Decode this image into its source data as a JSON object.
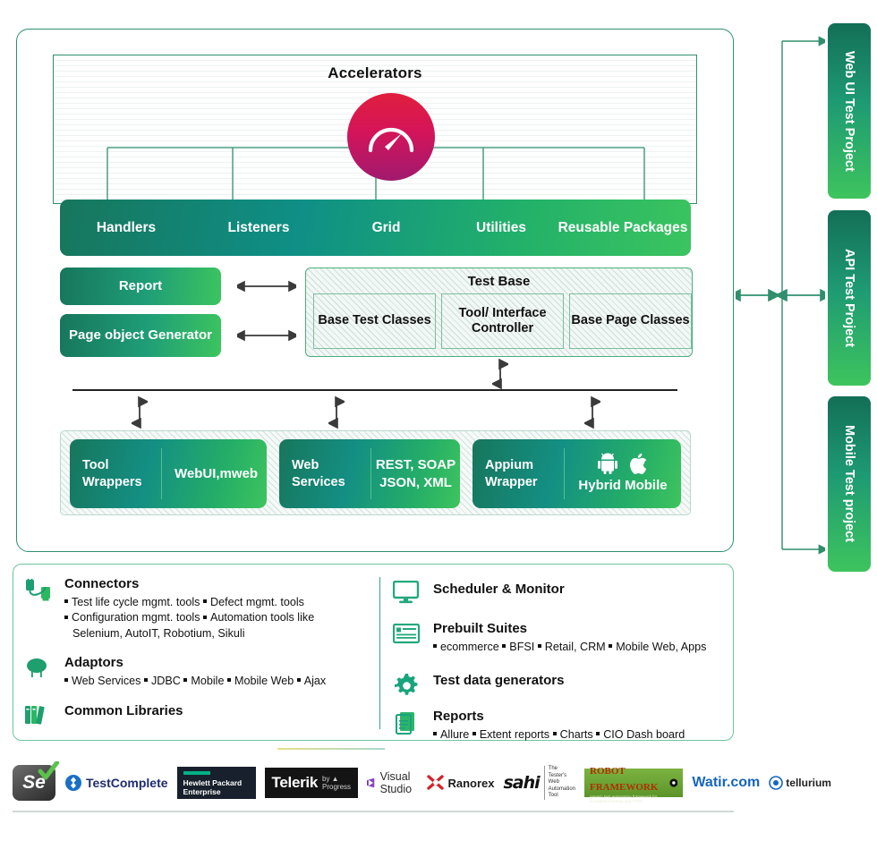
{
  "accelerators": {
    "title": "Accelerators",
    "icon": "speedometer-icon",
    "items": [
      "Handlers",
      "Listeners",
      "Grid",
      "Utilities",
      "Reusable Packages"
    ]
  },
  "left_column": {
    "report": "Report",
    "page_object_generator": "Page object Generator"
  },
  "test_base": {
    "title": "Test Base",
    "cells": [
      "Base Test Classes",
      "Tool/ Interface Controller",
      "Base Page Classes"
    ]
  },
  "wrappers": [
    {
      "left": "Tool Wrappers",
      "right": "WebUI,mweb",
      "icons": []
    },
    {
      "left": "Web Services",
      "right": "REST, SOAP JSON, XML",
      "icons": []
    },
    {
      "left": "Appium Wrapper",
      "right": "Hybrid Mobile",
      "icons": [
        "android-icon",
        "apple-icon"
      ]
    }
  ],
  "test_projects": [
    "Web UI Test Project",
    "API Test Project",
    "Mobile Test project"
  ],
  "services_left": [
    {
      "icon": "connector-plug-icon",
      "title": "Connectors",
      "lines": [
        [
          "Test life cycle mgmt. tools",
          "Defect mgmt. tools"
        ],
        [
          "Configuration mgmt. tools",
          "Automation tools like"
        ]
      ],
      "continuation": "Selenium, AutoIT, Robotium, Sikuli"
    },
    {
      "icon": "capacitor-icon",
      "title": "Adaptors",
      "lines": [
        [
          "Web Services",
          "JDBC",
          "Mobile",
          "Mobile Web",
          "Ajax"
        ]
      ],
      "continuation": ""
    },
    {
      "icon": "books-icon",
      "title": "Common Libraries",
      "lines": [],
      "continuation": ""
    }
  ],
  "services_right": [
    {
      "icon": "monitor-icon",
      "title": "Scheduler & Monitor",
      "lines": []
    },
    {
      "icon": "card-document-icon",
      "title": "Prebuilt Suites",
      "lines": [
        [
          "ecommerce",
          "BFSI",
          "Retail, CRM",
          "Mobile Web, Apps"
        ]
      ]
    },
    {
      "icon": "gear-icon",
      "title": "Test data generators",
      "lines": []
    },
    {
      "icon": "documents-icon",
      "title": "Reports",
      "lines": [
        [
          "Allure",
          "Extent reports",
          "Charts",
          "CIO Dash board"
        ]
      ]
    }
  ],
  "logos": [
    {
      "name": "selenium-logo",
      "text": "Se"
    },
    {
      "name": "testcomplete-logo",
      "text": "TestComplete"
    },
    {
      "name": "hpe-logo",
      "line1": "Hewlett Packard",
      "line2": "Enterprise"
    },
    {
      "name": "telerik-logo",
      "text": "Telerik",
      "sub": "by ▲ Progress"
    },
    {
      "name": "visual-studio-logo",
      "text": "Visual Studio"
    },
    {
      "name": "ranorex-logo",
      "text": "Ranorex"
    },
    {
      "name": "sahi-logo",
      "text": "sahi",
      "sub": "The Tester's Web Automation Tool"
    },
    {
      "name": "robot-framework-logo",
      "text": "ROBOT FRAMEWORK",
      "sub": "generic test automation framework for acceptance testing and ATDD"
    },
    {
      "name": "watir-logo",
      "text": "Watir.com"
    },
    {
      "name": "tellurium-logo",
      "text": "tellurium"
    }
  ],
  "colors": {
    "green_dark": "#17765c",
    "green_light": "#3ec45e",
    "teal": "#0f8f86",
    "accent_red": "#e01f3d",
    "accent_magenta": "#a01a6e",
    "frame_border": "#2f8f6d"
  }
}
